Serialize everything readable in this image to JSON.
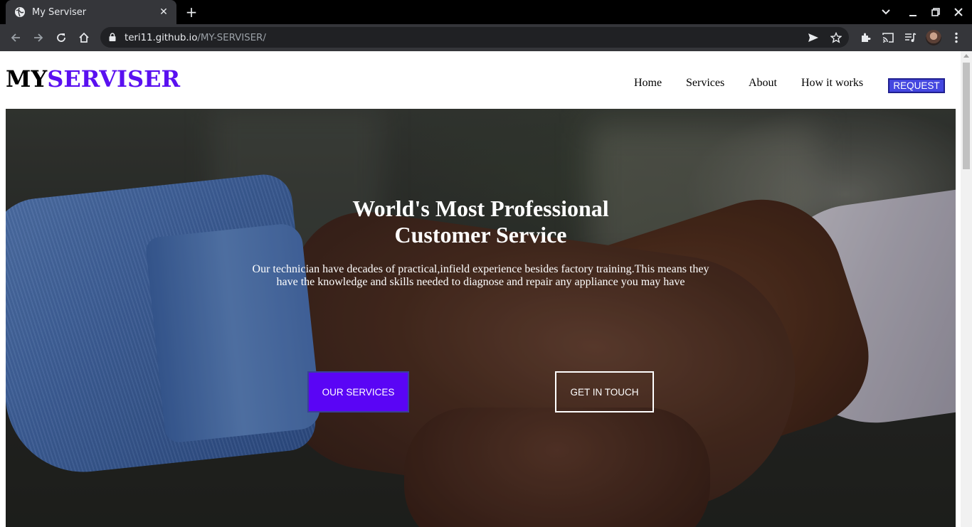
{
  "browser": {
    "tab_title": "My Serviser",
    "tab_close": "✕",
    "new_tab": "+",
    "url_host": "teri11.github.io",
    "url_path": "/MY-SERVISER/"
  },
  "site": {
    "logo_part1": "MY",
    "logo_part2": "SERVISER",
    "brand_color": "#5a10f0"
  },
  "nav": {
    "items": [
      {
        "label": "Home"
      },
      {
        "label": "Services"
      },
      {
        "label": "About"
      },
      {
        "label": "How it works"
      }
    ],
    "request_label": "REQUEST"
  },
  "hero": {
    "title_line1": "World's Most Professional",
    "title_line2": "Customer Service",
    "text_line1": "Our technician have decades of practical,infield experience besides factory training.This means they",
    "text_line2": "have the knowledge and skills needed to diagnose and repair any appliance you may have",
    "primary_button": "OUR SERVICES",
    "secondary_button": "GET IN TOUCH",
    "primary_color": "#5a05f5"
  }
}
